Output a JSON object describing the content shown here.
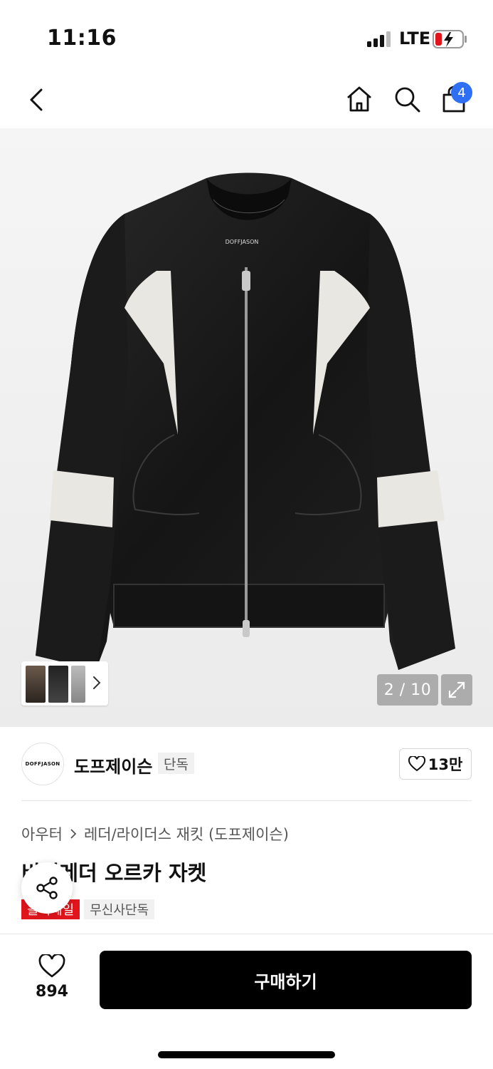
{
  "status_bar": {
    "time": "11:16",
    "network": "LTE"
  },
  "nav": {
    "cart_count": "4",
    "icons": [
      "chevron-left-icon",
      "home-icon",
      "search-icon",
      "shopping-bag-icon"
    ]
  },
  "gallery": {
    "counter": "2 / 10",
    "brand_print": "DOFFJASON"
  },
  "brand": {
    "logo_text": "DOFFJASON",
    "name": "도프제이슨",
    "tag": "단독",
    "likes": "13만"
  },
  "breadcrumb": {
    "category": "아우터",
    "subcategory": "레더/라이더스 재킷 (도프제이슨)"
  },
  "product": {
    "title": "비건레더 오르카 자켓",
    "badges": {
      "sale": "올킥세일",
      "exclusive": "무신사단독"
    }
  },
  "bottom": {
    "wish_count": "894",
    "buy_label": "구매하기"
  },
  "colors": {
    "accent_blue": "#2f6ff4",
    "sale_red": "#e1151b",
    "primary": "#000000"
  }
}
